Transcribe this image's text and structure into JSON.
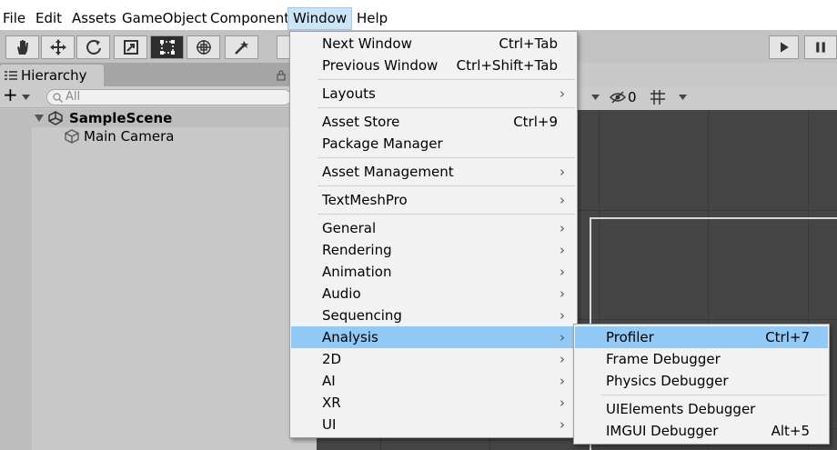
{
  "menubar": {
    "items": [
      "File",
      "Edit",
      "Assets",
      "GameObject",
      "Component",
      "Window",
      "Help"
    ],
    "active": "Window"
  },
  "toolbar": {
    "tools": [
      "hand-tool-icon",
      "move-tool-icon",
      "rotate-tool-icon",
      "scale-tool-icon",
      "rect-tool-icon",
      "transform-tool-icon",
      "custom-tool-icon"
    ],
    "selected": "rect-tool-icon",
    "play_controls": [
      "play-icon",
      "pause-icon"
    ]
  },
  "hierarchy": {
    "tab_label": "Hierarchy",
    "add_label": "+",
    "search_placeholder": "All",
    "scene_name": "SampleScene",
    "objects": [
      "Main Camera"
    ]
  },
  "scene_toolbar": {
    "hidden_count": "0"
  },
  "window_menu": {
    "items": [
      {
        "label": "Next Window",
        "shortcut": "Ctrl+Tab"
      },
      {
        "label": "Previous Window",
        "shortcut": "Ctrl+Shift+Tab"
      },
      {
        "label": "Layouts",
        "arrow": "›"
      },
      {
        "label": "Asset Store",
        "shortcut": "Ctrl+9"
      },
      {
        "label": "Package Manager"
      },
      {
        "label": "Asset Management",
        "arrow": "›"
      },
      {
        "label": "TextMeshPro",
        "arrow": "›"
      },
      {
        "label": "General",
        "arrow": "›"
      },
      {
        "label": "Rendering",
        "arrow": "›"
      },
      {
        "label": "Animation",
        "arrow": "›"
      },
      {
        "label": "Audio",
        "arrow": "›"
      },
      {
        "label": "Sequencing",
        "arrow": "›"
      },
      {
        "label": "Analysis",
        "arrow": "›",
        "highlighted": true
      },
      {
        "label": "2D",
        "arrow": "›"
      },
      {
        "label": "AI",
        "arrow": "›"
      },
      {
        "label": "XR",
        "arrow": "›"
      },
      {
        "label": "UI",
        "arrow": "›"
      }
    ]
  },
  "analysis_submenu": {
    "items": [
      {
        "label": "Profiler",
        "shortcut": "Ctrl+7",
        "highlighted": true
      },
      {
        "label": "Frame Debugger"
      },
      {
        "label": "Physics Debugger"
      },
      {
        "label": "UIElements Debugger"
      },
      {
        "label": "IMGUI Debugger",
        "shortcut": "Alt+5"
      }
    ]
  },
  "colors": {
    "menu_highlight": "#91c9f7",
    "active_menubar": "#cce4f7",
    "scene_background": "#454545"
  }
}
